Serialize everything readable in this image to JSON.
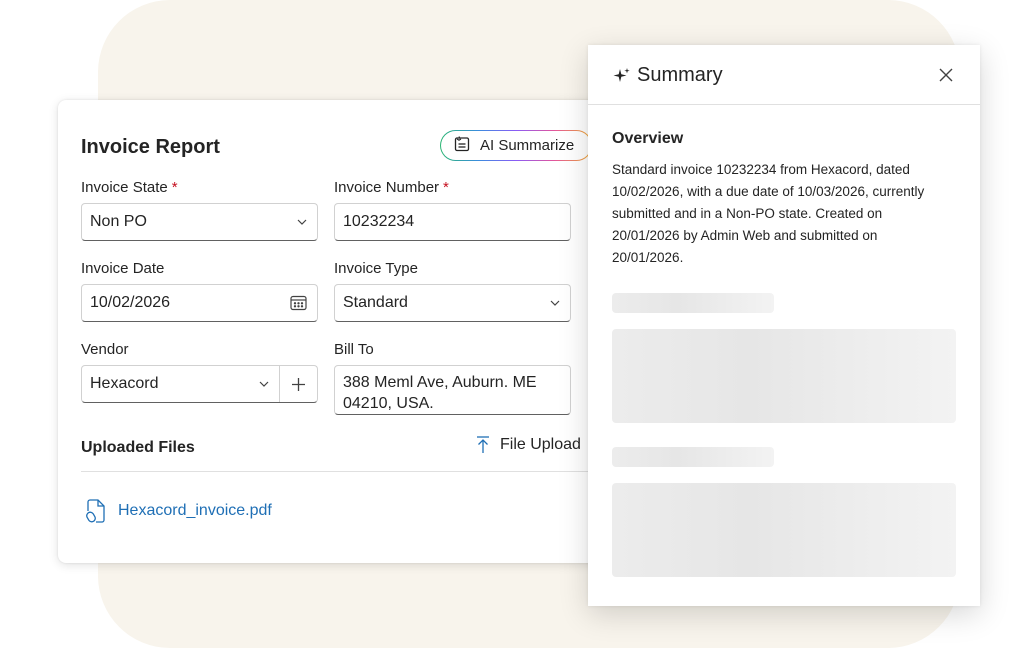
{
  "invoice": {
    "title": "Invoice Report",
    "ai_button_label": "AI Summarize",
    "fields": {
      "invoice_state": {
        "label": "Invoice State",
        "value": "Non PO",
        "required_mark": "*"
      },
      "invoice_number": {
        "label": "Invoice Number",
        "value": "10232234",
        "required_mark": "*"
      },
      "invoice_date": {
        "label": "Invoice Date",
        "value": "10/02/2026"
      },
      "invoice_type": {
        "label": "Invoice Type",
        "value": "Standard"
      },
      "vendor": {
        "label": "Vendor",
        "value": "Hexacord"
      },
      "bill_to": {
        "label": "Bill To",
        "line1": "388 Meml Ave, Auburn. ME",
        "line2": "04210, USA."
      }
    },
    "uploaded_files": {
      "title": "Uploaded Files",
      "upload_label": "File Upload",
      "files": [
        "Hexacord_invoice.pdf"
      ]
    }
  },
  "summary_panel": {
    "title": "Summary",
    "overview_heading": "Overview",
    "overview_text": "Standard invoice 10232234 from Hexacord, dated 10/02/2026, with a due date of 10/03/2026, currently submitted and in a Non-PO state. Created on 20/01/2026 by Admin Web and submitted on 20/01/2026."
  },
  "icons": {
    "ai_summarize": "ai-document-icon",
    "calendar": "calendar-icon",
    "chevron": "chevron-down-icon",
    "add": "plus-icon",
    "upload": "upload-arrow-icon",
    "file": "pdf-file-icon",
    "sparkle": "sparkle-icon",
    "close": "close-icon"
  },
  "colors": {
    "background_blob": "#f8f4ec",
    "required": "#c50f1f",
    "link": "#1f6fb5",
    "skeleton": "#ececec"
  }
}
